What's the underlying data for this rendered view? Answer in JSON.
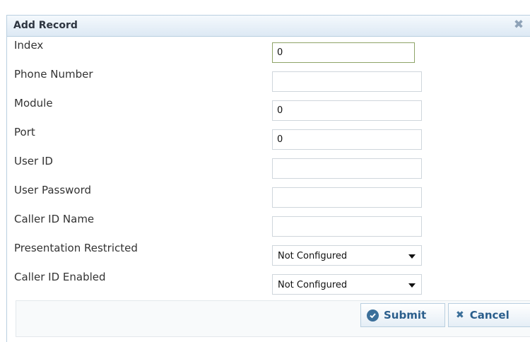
{
  "dialog": {
    "title": "Add Record",
    "close_glyph": "✖"
  },
  "fields": [
    {
      "label": "Index",
      "value": "0",
      "type": "text"
    },
    {
      "label": "Phone Number",
      "value": "",
      "type": "text"
    },
    {
      "label": "Module",
      "value": "0",
      "type": "text"
    },
    {
      "label": "Port",
      "value": "0",
      "type": "text"
    },
    {
      "label": "User ID",
      "value": "",
      "type": "text"
    },
    {
      "label": "User Password",
      "value": "",
      "type": "text"
    },
    {
      "label": "Caller ID Name",
      "value": "",
      "type": "text"
    },
    {
      "label": "Presentation Restricted",
      "value": "Not Configured",
      "type": "select"
    },
    {
      "label": "Caller ID Enabled",
      "value": "Not Configured",
      "type": "select"
    }
  ],
  "buttons": {
    "submit": "Submit",
    "cancel": "Cancel",
    "submit_icon": "check-circle-icon",
    "cancel_icon": "close-icon"
  },
  "colors": {
    "accent": "#2a5e8c",
    "header_bg": "#dde9f4",
    "border": "#b9cfe0"
  }
}
